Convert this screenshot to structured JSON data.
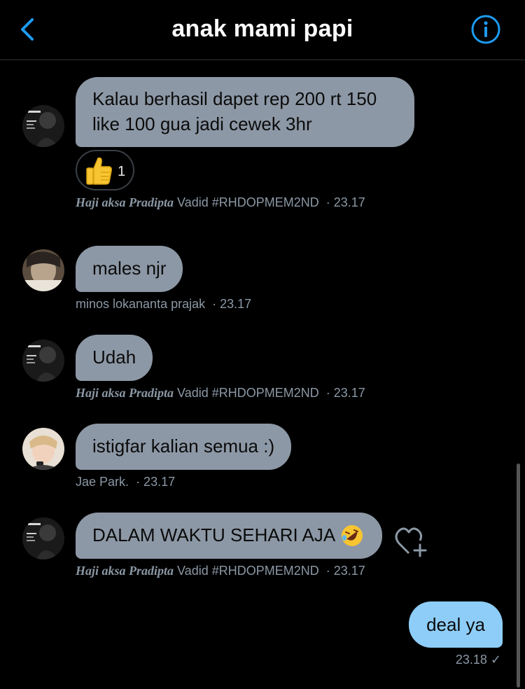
{
  "header": {
    "title": "anak mami papi",
    "back_icon": "chevron-left-icon",
    "info_icon": "info-circle-icon",
    "accent": "#1d9bf0"
  },
  "messages": [
    {
      "text_line1": "Kalau berhasil dapet rep 200 rt 150",
      "text_line2": "like 100 gua jadi cewek 3hr",
      "reaction_emoji": "thumbs-up",
      "reaction_count": "1",
      "sender_fancy": "Haji aksa Pradipta",
      "sender_rest": "Vadid #RHDOPMEM2ND",
      "time": "· 23.17"
    },
    {
      "text": "males njr",
      "sender": "minos lokananta prajak",
      "time": "· 23.17"
    },
    {
      "text": "Udah",
      "sender_fancy": "Haji aksa Pradipta",
      "sender_rest": "Vadid #RHDOPMEM2ND",
      "time": "· 23.17"
    },
    {
      "text": "istigfar kalian semua :)",
      "sender": "Jae Park.",
      "time": "· 23.17"
    },
    {
      "text": "DALAM WAKTU SEHARI AJA",
      "emoji": "rolling-on-floor-laughing",
      "sender_fancy": "Haji aksa Pradipta",
      "sender_rest": "Vadid #RHDOPMEM2ND",
      "time": "· 23.17"
    }
  ],
  "own_message": {
    "text": "deal ya",
    "time": "23.18 ✓",
    "bubble_color": "#8ecdf8"
  },
  "colors": {
    "background": "#000000",
    "bubble_other": "#8d98a6",
    "meta_text": "#8b98a5"
  }
}
